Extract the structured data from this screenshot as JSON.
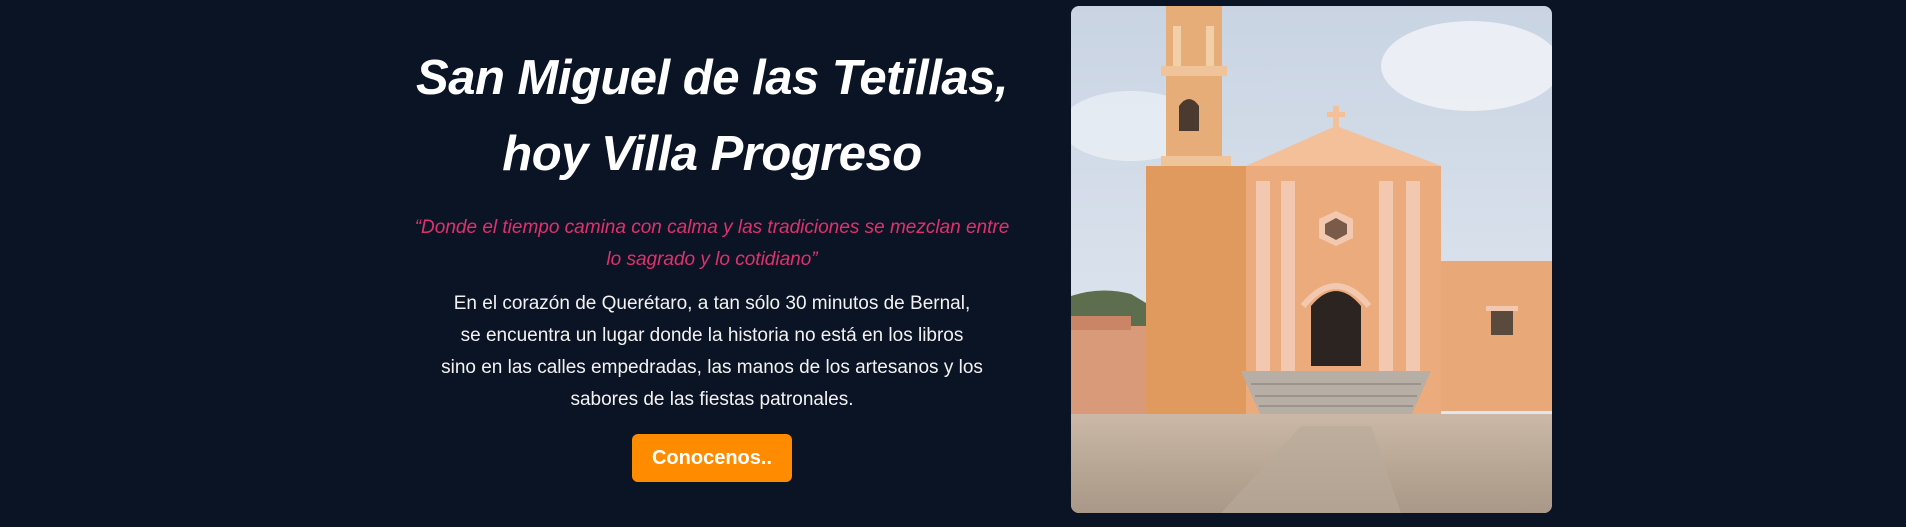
{
  "hero": {
    "title_line1": "San Miguel de las Tetillas,",
    "title_line2": "hoy Villa Progreso",
    "quote": "“Donde el tiempo camina con calma y las tradiciones se mezclan entre lo sagrado y lo cotidiano”",
    "body_lines": [
      "En el corazón de Querétaro, a tan sólo 30 minutos de Bernal,",
      "se encuentra un lugar donde la historia no está en los libros",
      "sino en las calles empedradas, las manos de los artesanos y los",
      "sabores de las fiestas patronales."
    ],
    "cta_label": "Conocenos..",
    "image_alt": "church-photo"
  },
  "colors": {
    "background": "#0b1424",
    "quote": "#e0316d",
    "button": "#ff8c00",
    "text": "#ffffff"
  }
}
